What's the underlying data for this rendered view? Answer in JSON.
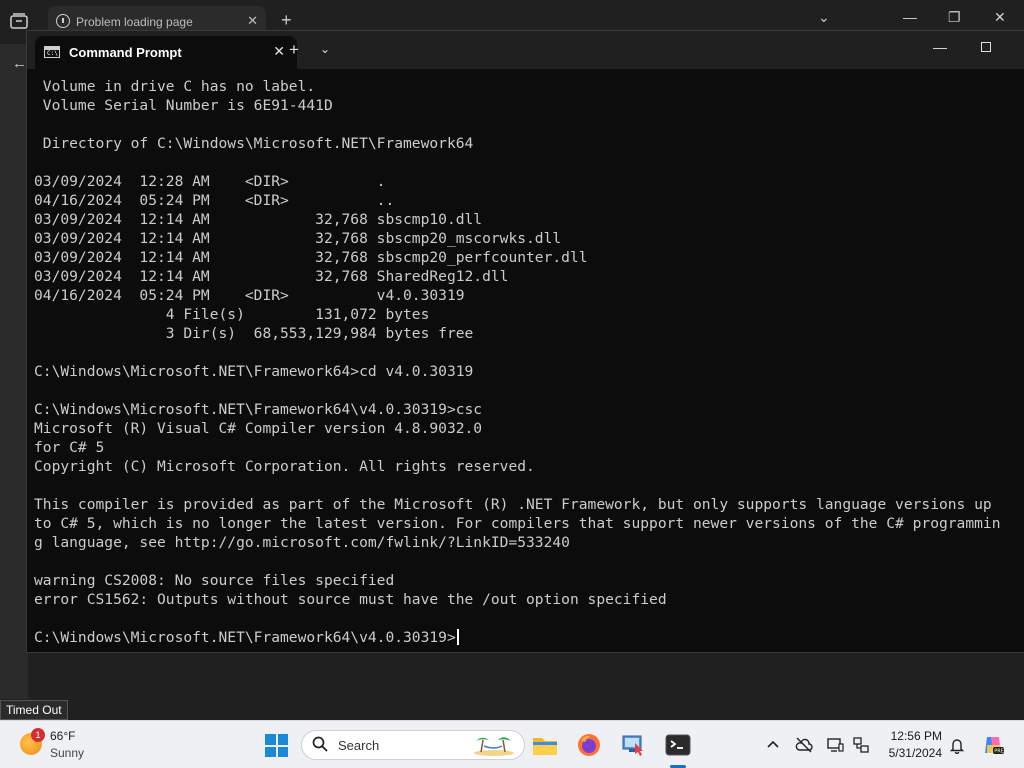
{
  "browser": {
    "tab_title": "Problem loading page",
    "tab_close": "✕",
    "new_tab": "+",
    "list_all_tabs": "⌄",
    "minimize": "—",
    "restore": "❐",
    "close": "✕",
    "back": "←"
  },
  "terminal": {
    "tab_title": "Command Prompt",
    "tab_close": "✕",
    "new_tab": "+",
    "dropdown": "⌄",
    "minimize": "—",
    "lines": [
      " Volume in drive C has no label.",
      " Volume Serial Number is 6E91-441D",
      "",
      " Directory of C:\\Windows\\Microsoft.NET\\Framework64",
      "",
      "03/09/2024  12:28 AM    <DIR>          .",
      "04/16/2024  05:24 PM    <DIR>          ..",
      "03/09/2024  12:14 AM            32,768 sbscmp10.dll",
      "03/09/2024  12:14 AM            32,768 sbscmp20_mscorwks.dll",
      "03/09/2024  12:14 AM            32,768 sbscmp20_perfcounter.dll",
      "03/09/2024  12:14 AM            32,768 SharedReg12.dll",
      "04/16/2024  05:24 PM    <DIR>          v4.0.30319",
      "               4 File(s)        131,072 bytes",
      "               3 Dir(s)  68,553,129,984 bytes free",
      "",
      "C:\\Windows\\Microsoft.NET\\Framework64>cd v4.0.30319",
      "",
      "C:\\Windows\\Microsoft.NET\\Framework64\\v4.0.30319>csc",
      "Microsoft (R) Visual C# Compiler version 4.8.9032.0",
      "for C# 5",
      "Copyright (C) Microsoft Corporation. All rights reserved.",
      "",
      "This compiler is provided as part of the Microsoft (R) .NET Framework, but only supports language versions up",
      "to C# 5, which is no longer the latest version. For compilers that support newer versions of the C# programmin",
      "g language, see http://go.microsoft.com/fwlink/?LinkID=533240",
      "",
      "warning CS2008: No source files specified",
      "error CS1562: Outputs without source must have the /out option specified",
      ""
    ],
    "prompt": "C:\\Windows\\Microsoft.NET\\Framework64\\v4.0.30319>"
  },
  "tooltip": "Timed Out",
  "taskbar": {
    "weather": {
      "badge": "1",
      "temp": "66°F",
      "condition": "Sunny"
    },
    "search_placeholder": "Search",
    "clock": {
      "time": "12:56 PM",
      "date": "5/31/2024"
    }
  },
  "colors": {
    "terminal_bg": "#0c0c0c",
    "terminal_text": "#cccccc",
    "titlebar_bg": "#202020",
    "taskbar_bg": "#eef0f3",
    "accent": "#1a8ad8"
  }
}
